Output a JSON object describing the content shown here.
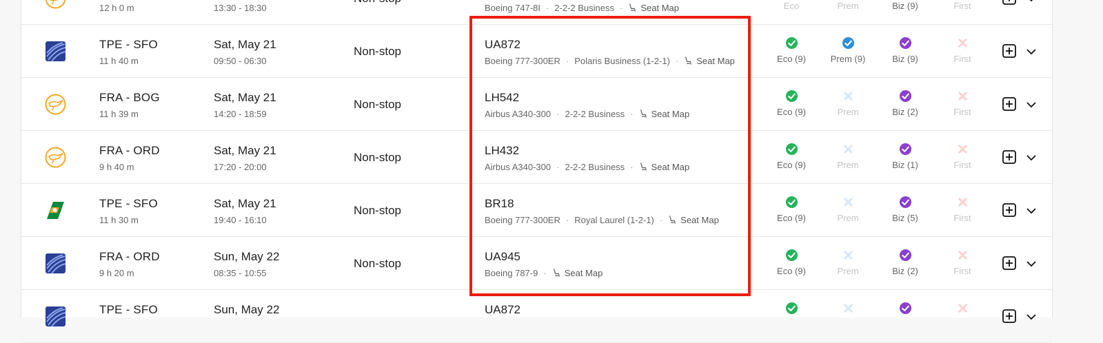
{
  "colors": {
    "available_green": "#27b35b",
    "available_blue": "#2d8fd8",
    "available_purple": "#8a3fd1",
    "unavailable_blue": "#d4e7f6",
    "unavailable_red": "#fbd0cf",
    "highlight_red": "#ee1c10"
  },
  "columns": {
    "cabins": [
      "Eco",
      "Prem",
      "Biz",
      "First"
    ]
  },
  "rows": [
    {
      "airline_logo": "lufthansa-crane-icon",
      "route": "",
      "duration": "12 h 0 m",
      "date": "",
      "times": "13:30 - 18:30",
      "stops": "Non-stop",
      "flight_number": "",
      "aircraft": "Boeing 747-8I",
      "seat_config": "2-2-2 Business",
      "seat_map": "Seat Map",
      "cabins": {
        "eco": {
          "label": "Eco",
          "available": false
        },
        "prem": {
          "label": "Prem",
          "available": false
        },
        "biz": {
          "label": "Biz (9)",
          "available": true
        },
        "first": {
          "label": "First",
          "available": false
        }
      }
    },
    {
      "airline_logo": "united-globe-icon",
      "route": "TPE - SFO",
      "duration": "11 h 40 m",
      "date": "Sat, May 21",
      "times": "09:50 - 06:30",
      "stops": "Non-stop",
      "flight_number": "UA872",
      "aircraft": "Boeing 777-300ER",
      "seat_config": "Polaris Business (1-2-1)",
      "seat_map": "Seat Map",
      "cabins": {
        "eco": {
          "label": "Eco (9)",
          "available": true
        },
        "prem": {
          "label": "Prem (9)",
          "available": true
        },
        "biz": {
          "label": "Biz (9)",
          "available": true
        },
        "first": {
          "label": "First",
          "available": false
        }
      }
    },
    {
      "airline_logo": "lufthansa-crane-icon",
      "route": "FRA - BOG",
      "duration": "11 h 39 m",
      "date": "Sat, May 21",
      "times": "14:20 - 18:59",
      "stops": "Non-stop",
      "flight_number": "LH542",
      "aircraft": "Airbus A340-300",
      "seat_config": "2-2-2 Business",
      "seat_map": "Seat Map",
      "cabins": {
        "eco": {
          "label": "Eco (9)",
          "available": true
        },
        "prem": {
          "label": "Prem",
          "available": false
        },
        "biz": {
          "label": "Biz (2)",
          "available": true
        },
        "first": {
          "label": "First",
          "available": false
        }
      }
    },
    {
      "airline_logo": "lufthansa-crane-icon",
      "route": "FRA - ORD",
      "duration": "9 h 40 m",
      "date": "Sat, May 21",
      "times": "17:20 - 20:00",
      "stops": "Non-stop",
      "flight_number": "LH432",
      "aircraft": "Airbus A340-300",
      "seat_config": "2-2-2 Business",
      "seat_map": "Seat Map",
      "cabins": {
        "eco": {
          "label": "Eco (9)",
          "available": true
        },
        "prem": {
          "label": "Prem",
          "available": false
        },
        "biz": {
          "label": "Biz (1)",
          "available": true
        },
        "first": {
          "label": "First",
          "available": false
        }
      }
    },
    {
      "airline_logo": "eva-air-icon",
      "route": "TPE - SFO",
      "duration": "11 h 30 m",
      "date": "Sat, May 21",
      "times": "19:40 - 16:10",
      "stops": "Non-stop",
      "flight_number": "BR18",
      "aircraft": "Boeing 777-300ER",
      "seat_config": "Royal Laurel (1-2-1)",
      "seat_map": "Seat Map",
      "cabins": {
        "eco": {
          "label": "Eco (9)",
          "available": true
        },
        "prem": {
          "label": "Prem",
          "available": false
        },
        "biz": {
          "label": "Biz (5)",
          "available": true
        },
        "first": {
          "label": "First",
          "available": false
        }
      }
    },
    {
      "airline_logo": "united-globe-icon",
      "route": "FRA - ORD",
      "duration": "9 h 20 m",
      "date": "Sun, May 22",
      "times": "08:35 - 10:55",
      "stops": "Non-stop",
      "flight_number": "UA945",
      "aircraft": "Boeing 787-9",
      "seat_config": "",
      "seat_map": "Seat Map",
      "cabins": {
        "eco": {
          "label": "Eco (9)",
          "available": true
        },
        "prem": {
          "label": "Prem",
          "available": false
        },
        "biz": {
          "label": "Biz (2)",
          "available": true
        },
        "first": {
          "label": "First",
          "available": false
        }
      }
    },
    {
      "airline_logo": "united-globe-icon",
      "route": "TPE - SFO",
      "duration": "",
      "date": "Sun, May 22",
      "times": "",
      "stops": "",
      "flight_number": "UA872",
      "aircraft": "",
      "seat_config": "",
      "seat_map": "",
      "cabins": {
        "eco": {
          "label": "",
          "available": true
        },
        "prem": {
          "label": "",
          "available": false
        },
        "biz": {
          "label": "",
          "available": true
        },
        "first": {
          "label": "",
          "available": false
        }
      }
    }
  ]
}
